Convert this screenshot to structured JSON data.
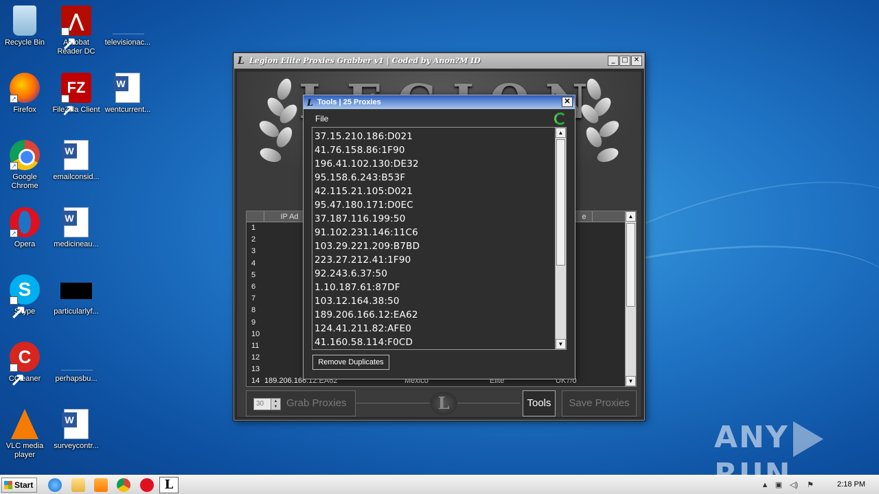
{
  "desktop": {
    "icons": [
      {
        "label": "Recycle Bin"
      },
      {
        "label": "Acrobat Reader DC"
      },
      {
        "label": "televisionac..."
      },
      {
        "label": "Firefox"
      },
      {
        "label": "FileZilla Client"
      },
      {
        "label": "wentcurrent..."
      },
      {
        "label": "Google Chrome"
      },
      {
        "label": "emailconsid..."
      },
      {
        "label": "Opera"
      },
      {
        "label": "medicineau..."
      },
      {
        "label": "Skype"
      },
      {
        "label": "particularlyf..."
      },
      {
        "label": "CCleaner"
      },
      {
        "label": "perhapsbu..."
      },
      {
        "label": "VLC media player"
      },
      {
        "label": "surveycontr..."
      }
    ]
  },
  "legion": {
    "title": "Legion Elite Proxies Grabber v1 | Coded by Anon?M ID",
    "banner_text": "LEGION",
    "logo_letter": "L",
    "grid": {
      "header_ip": "IP Ad",
      "header_port": "e",
      "rows": [
        {
          "num": "1",
          "ip": "37.15."
        },
        {
          "num": "2",
          "ip": "41.76"
        },
        {
          "num": "3",
          "ip": "196.41."
        },
        {
          "num": "4",
          "ip": "95.15("
        },
        {
          "num": "5",
          "ip": "42.115"
        },
        {
          "num": "6",
          "ip": "95.47.1"
        },
        {
          "num": "7",
          "ip": "37.18"
        },
        {
          "num": "8",
          "ip": "91.102."
        },
        {
          "num": "9",
          "ip": "103.29."
        },
        {
          "num": "10",
          "ip": "223.27"
        },
        {
          "num": "11",
          "ip": "92.2"
        },
        {
          "num": "12",
          "ip": "1.10."
        },
        {
          "num": "13",
          "ip": "103.1"
        },
        {
          "num": "14",
          "ip": "189.206.166.12:EA62",
          "country": "Mexico",
          "type": "Elite",
          "port": "UK7/0"
        }
      ]
    },
    "spin_value": "30",
    "grab_label": "Grab Proxies",
    "tools_label": "Tools",
    "save_label": "Save Proxies"
  },
  "tools": {
    "title": "Tools | 25 Proxies",
    "menu_file": "File",
    "proxies": [
      "37.15.210.186:D021",
      "41.76.158.86:1F90",
      "196.41.102.130:DE32",
      "95.158.6.243:B53F",
      "42.115.21.105:D021",
      "95.47.180.171:D0EC",
      "37.187.116.199:50",
      "91.102.231.146:11C6",
      "103.29.221.209:B7BD",
      "223.27.212.41:1F90",
      "92.243.6.37:50",
      "1.10.187.61:87DF",
      "103.12.164.38:50",
      "189.206.166.12:EA62",
      "124.41.211.82:AFE0",
      "41.160.58.114:F0CD"
    ],
    "remove_duplicates_label": "Remove Duplicates"
  },
  "watermark": {
    "left": "ANY",
    "right": "RUN"
  },
  "taskbar": {
    "start_label": "Start",
    "legion_letter": "L",
    "clock": "2:18 PM"
  }
}
